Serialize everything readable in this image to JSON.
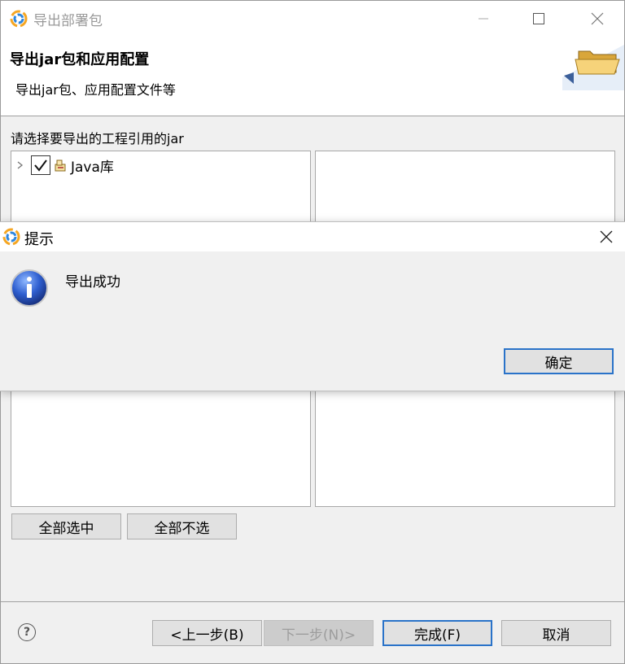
{
  "main_window": {
    "title": "导出部署包",
    "header_title": "导出jar包和应用配置",
    "header_desc": "导出jar包、应用配置文件等",
    "select_label": "请选择要导出的工程引用的jar",
    "tree_items": [
      {
        "label": "Java库",
        "checked": true
      }
    ],
    "buttons": {
      "select_all": "全部选中",
      "deselect_all": "全部不选",
      "back": "<上一步(B)",
      "next": "下一步(N)>",
      "finish": "完成(F)",
      "cancel": "取消",
      "help": "?"
    }
  },
  "dialog": {
    "title": "提示",
    "message": "导出成功",
    "ok": "确定"
  },
  "colors": {
    "accent": "#2a73c9",
    "window_bg": "#f0f0f0",
    "disabled_text": "#9d9d9d"
  }
}
